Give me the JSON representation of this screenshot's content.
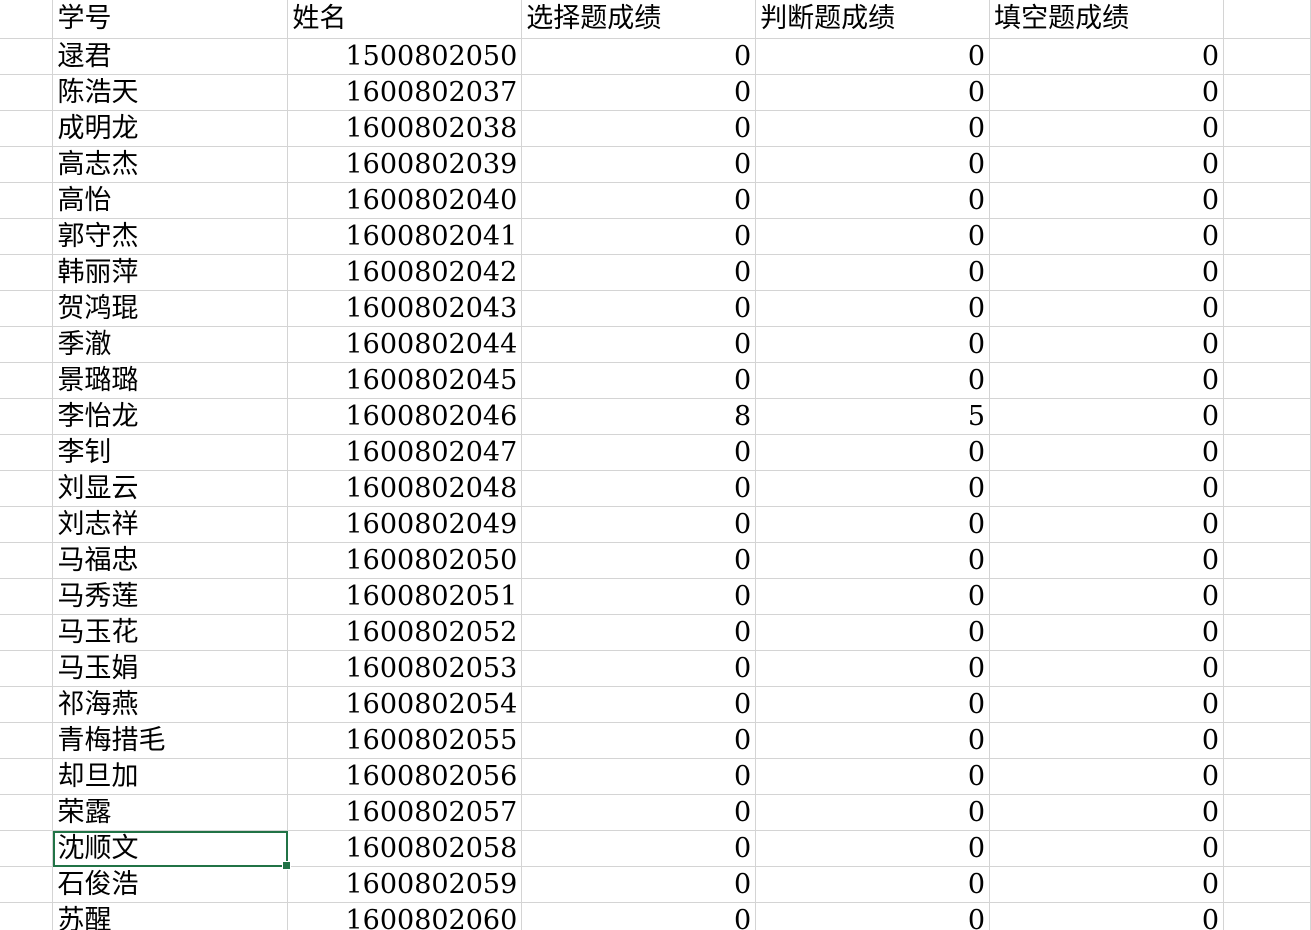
{
  "headers": [
    "学号",
    "姓名",
    "选择题成绩",
    "判断题成绩",
    "填空题成绩"
  ],
  "rows": [
    [
      "逯君",
      "1500802050",
      "0",
      "0",
      "0"
    ],
    [
      "陈浩天",
      "1600802037",
      "0",
      "0",
      "0"
    ],
    [
      "成明龙",
      "1600802038",
      "0",
      "0",
      "0"
    ],
    [
      "高志杰",
      "1600802039",
      "0",
      "0",
      "0"
    ],
    [
      "高怡",
      "1600802040",
      "0",
      "0",
      "0"
    ],
    [
      "郭守杰",
      "1600802041",
      "0",
      "0",
      "0"
    ],
    [
      "韩丽萍",
      "1600802042",
      "0",
      "0",
      "0"
    ],
    [
      "贺鸿琨",
      "1600802043",
      "0",
      "0",
      "0"
    ],
    [
      "季澈",
      "1600802044",
      "0",
      "0",
      "0"
    ],
    [
      "景璐璐",
      "1600802045",
      "0",
      "0",
      "0"
    ],
    [
      "李怡龙",
      "1600802046",
      "8",
      "5",
      "0"
    ],
    [
      "李钊",
      "1600802047",
      "0",
      "0",
      "0"
    ],
    [
      "刘显云",
      "1600802048",
      "0",
      "0",
      "0"
    ],
    [
      "刘志祥",
      "1600802049",
      "0",
      "0",
      "0"
    ],
    [
      "马福忠",
      "1600802050",
      "0",
      "0",
      "0"
    ],
    [
      "马秀莲",
      "1600802051",
      "0",
      "0",
      "0"
    ],
    [
      "马玉花",
      "1600802052",
      "0",
      "0",
      "0"
    ],
    [
      "马玉娟",
      "1600802053",
      "0",
      "0",
      "0"
    ],
    [
      "祁海燕",
      "1600802054",
      "0",
      "0",
      "0"
    ],
    [
      "青梅措毛",
      "1600802055",
      "0",
      "0",
      "0"
    ],
    [
      "却旦加",
      "1600802056",
      "0",
      "0",
      "0"
    ],
    [
      "荣露",
      "1600802057",
      "0",
      "0",
      "0"
    ],
    [
      "沈顺文",
      "1600802058",
      "0",
      "0",
      "0"
    ],
    [
      "石俊浩",
      "1600802059",
      "0",
      "0",
      "0"
    ],
    [
      "苏醒",
      "1600802060",
      "0",
      "0",
      "0"
    ]
  ],
  "selected_row": 22,
  "colors": {
    "gridline": "#d4d4d4",
    "selection": "#217346"
  }
}
